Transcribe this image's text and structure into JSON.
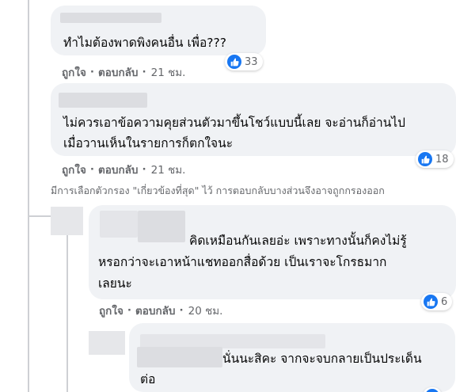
{
  "comments": [
    {
      "text_lines": [
        "ทำไมต้องพาดพิงคนอื่น เพื่อ???"
      ],
      "reaction": {
        "icon": "like-icon",
        "count": "33"
      },
      "actions": {
        "like": "ถูกใจ",
        "reply": "ตอบกลับ",
        "time": "21 ชม."
      }
    },
    {
      "text_lines": [
        "ไม่ควรเอาข้อความคุยส่วนตัวมาขึ้นโชว์แบบนี้เลย จะอ่านก็อ่านไป",
        "เมื่อวานเห็นในรายการก็ตกใจนะ"
      ],
      "reaction": {
        "icon": "like-icon",
        "count": "18"
      },
      "actions": {
        "like": "ถูกใจ",
        "reply": "ตอบกลับ",
        "time": "21 ชม."
      }
    }
  ],
  "filter_note": "มีการเลือกตัวกรอง \"เกี่ยวข้องที่สุด\" ไว้ การตอบกลับบางส่วนจึงอาจถูกกรองออก",
  "replies": [
    {
      "text_lines": [
        "คิดเหมือนกันเลยอ่ะ เพราะทางนั้นก็คงไม่รู้",
        "หรอกว่าจะเอาหน้าแชทออกสื่อด้วย เป็นเราจะโกรธมาก",
        "เลยนะ"
      ],
      "reaction": {
        "icon": "like-icon",
        "count": "6"
      },
      "actions": {
        "like": "ถูกใจ",
        "reply": "ตอบกลับ",
        "time": "20 ชม."
      }
    },
    {
      "text_lines": [
        "นั่นนะสิคะ จากจะจบกลายเป็นประเด็น",
        "ต่อ"
      ],
      "reaction": {
        "icon": "like-icon"
      }
    }
  ],
  "colors": {
    "accent": "#1877f2",
    "bubble": "#f0f2f5",
    "meta": "#65676b"
  }
}
